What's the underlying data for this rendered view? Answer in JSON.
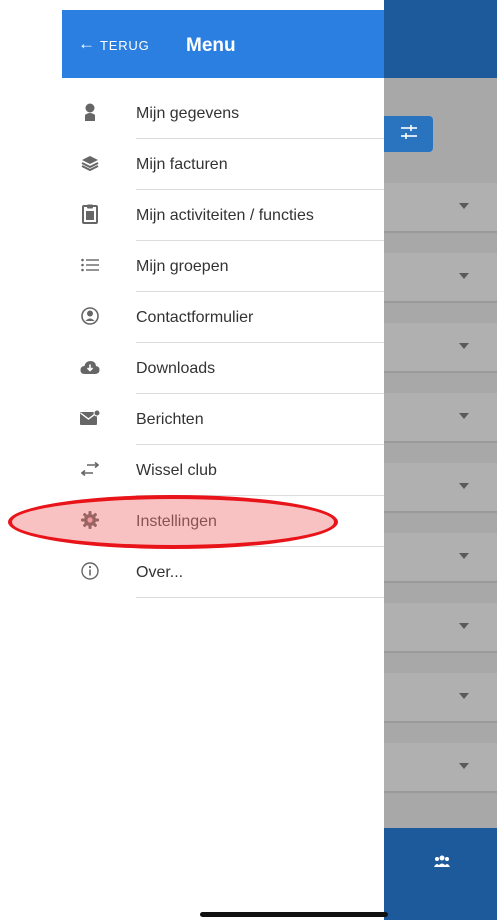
{
  "header": {
    "back_arrow": "←",
    "back_label": "TERUG",
    "title": "Menu"
  },
  "menu": {
    "items": [
      {
        "label": "Mijn gegevens",
        "icon": "person-icon"
      },
      {
        "label": "Mijn facturen",
        "icon": "layers-icon"
      },
      {
        "label": "Mijn activiteiten / functies",
        "icon": "clipboard-icon"
      },
      {
        "label": "Mijn groepen",
        "icon": "list-icon"
      },
      {
        "label": "Contactformulier",
        "icon": "contact-circle-icon"
      },
      {
        "label": "Downloads",
        "icon": "cloud-download-icon"
      },
      {
        "label": "Berichten",
        "icon": "mail-icon"
      },
      {
        "label": "Wissel club",
        "icon": "swap-icon"
      },
      {
        "label": "Instellingen",
        "icon": "gear-icon",
        "highlighted": true
      },
      {
        "label": "Over...",
        "icon": "info-icon"
      }
    ]
  },
  "colors": {
    "header": "#2b7fe0",
    "background_app_bar": "#1d5a9b",
    "highlight": "#e8141a",
    "icon": "#666666"
  }
}
